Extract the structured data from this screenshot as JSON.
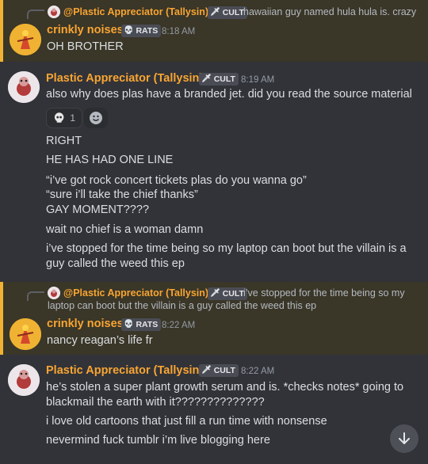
{
  "messages": [
    {
      "reply": {
        "name": "@Plastic Appreciator (Tallysin)",
        "tag": "CULT",
        "text": "hawaiian guy named hula hula is. crazy"
      },
      "author": "crinkly noises",
      "tag": "RATS",
      "time": "8:18 AM",
      "lines": [
        "OH BROTHER"
      ]
    },
    {
      "author": "Plastic Appreciator (Tallysin)",
      "tag": "CULT",
      "time": "8:19 AM",
      "lines": [
        "also why does plas have a branded jet. did you read the source material"
      ],
      "reaction": {
        "emoji": "skull-emoji",
        "count": "1"
      },
      "followups": [
        "RIGHT",
        "HE HAS HAD ONE LINE",
        "“i’ve got rock concert tickets plas do you wanna go”",
        "“sure i’ll take the chief thanks”",
        "GAY MOMENT????",
        "wait no chief is a woman damn",
        "i’ve stopped for the time being so my laptop can boot but the villain is a",
        "guy called the weed this ep"
      ]
    },
    {
      "reply": {
        "name": "@Plastic Appreciator (Tallysin)",
        "tag": "CULT",
        "text": "i’ve stopped for the time being so my",
        "text2": "laptop can boot but the villain is a guy called the weed this ep"
      },
      "author": "crinkly noises",
      "tag": "RATS",
      "time": "8:22 AM",
      "lines": [
        "nancy reagan’s life fr"
      ]
    },
    {
      "author": "Plastic Appreciator (Tallysin)",
      "tag": "CULT",
      "time": "8:22 AM",
      "lines": [
        "he’s stolen a super plant growth serum and is. *checks notes* going to",
        "blackmail the earth with it??????????????"
      ],
      "followups": [
        "i love old cartoons that just fill a run time with nonsense",
        "nevermind fuck tumblr i’m live blogging here"
      ]
    }
  ],
  "colors": {
    "name": "#f8a532",
    "highlight_bar": "#f0b232",
    "background": "#323339"
  },
  "icons": {
    "scroll": "arrow-down-icon",
    "add_reaction": "smiley-icon"
  }
}
